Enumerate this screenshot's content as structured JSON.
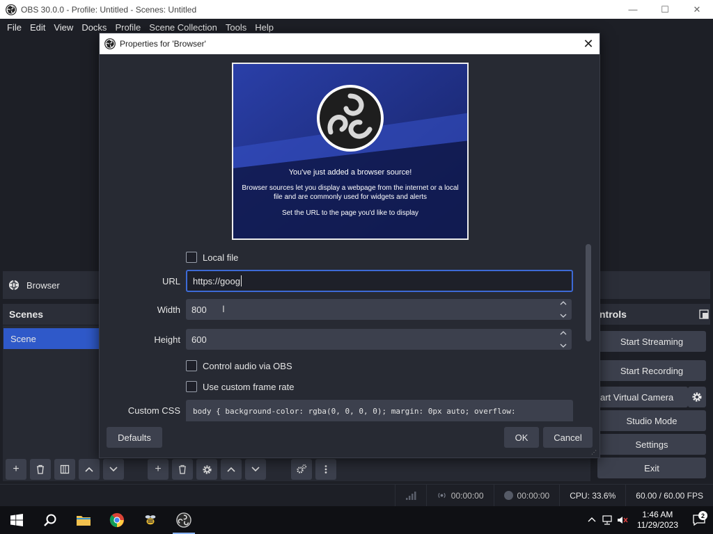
{
  "window": {
    "title": "OBS 30.0.0 - Profile: Untitled - Scenes: Untitled",
    "minimize": "—",
    "maximize": "☐",
    "close": "✕"
  },
  "menu": [
    "File",
    "Edit",
    "View",
    "Docks",
    "Profile",
    "Scene Collection",
    "Tools",
    "Help"
  ],
  "source_bar": {
    "label": "Browser"
  },
  "docks": {
    "scenes_title": "Scenes",
    "controls_title": "ntrols"
  },
  "scenes": [
    {
      "label": "Scene"
    }
  ],
  "controls": {
    "start_streaming": "Start Streaming",
    "start_recording": "Start Recording",
    "start_virtual_camera": "art Virtual Camera",
    "studio_mode": "Studio Mode",
    "settings": "Settings",
    "exit": "Exit"
  },
  "status": {
    "stream_time": "00:00:00",
    "record_time": "00:00:00",
    "cpu": "CPU: 33.6%",
    "fps": "60.00 / 60.00 FPS"
  },
  "taskbar": {
    "time": "1:46 AM",
    "date": "11/29/2023",
    "notification_count": "2"
  },
  "dialog": {
    "title": "Properties for 'Browser'",
    "close": "✕",
    "preview": {
      "headline": "You've just added a browser source!",
      "body_line1": "Browser sources let you display a webpage from the internet or a local",
      "body_line2": "file and are commonly used for widgets and alerts",
      "instruction": "Set the URL to the page you'd like to display"
    },
    "local_file_label": "Local file",
    "url_label": "URL",
    "url_value": "https://goog",
    "width_label": "Width",
    "width_value": "800",
    "height_label": "Height",
    "height_value": "600",
    "control_audio_label": "Control audio via OBS",
    "custom_frame_rate_label": "Use custom frame rate",
    "custom_css_label": "Custom CSS",
    "custom_css_value": "body { background-color: rgba(0, 0, 0, 0); margin: 0px auto; overflow:",
    "defaults_button": "Defaults",
    "ok_button": "OK",
    "cancel_button": "Cancel"
  }
}
